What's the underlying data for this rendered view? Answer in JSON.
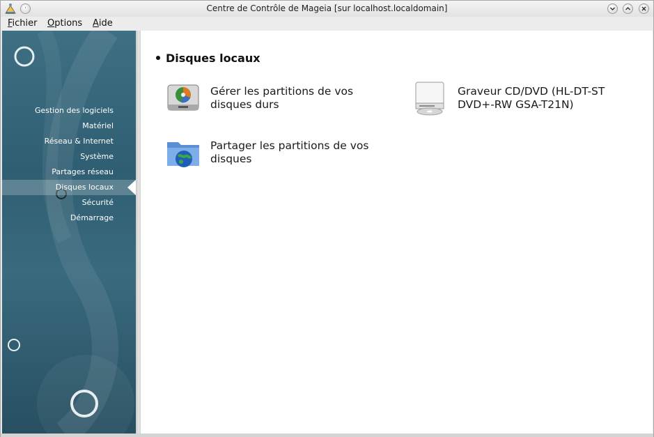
{
  "window": {
    "title": "Centre de Contrôle de Mageia  [sur localhost.localdomain]",
    "title_buttons": [
      "minimize",
      "maximize",
      "close"
    ]
  },
  "menubar": [
    {
      "label": "Fichier",
      "mnemonic": "F",
      "rest": "ichier"
    },
    {
      "label": "Options",
      "mnemonic": "O",
      "rest": "ptions"
    },
    {
      "label": "Aide",
      "mnemonic": "A",
      "rest": "ide"
    }
  ],
  "sidebar": {
    "items": [
      {
        "label": "Gestion des logiciels"
      },
      {
        "label": "Matériel"
      },
      {
        "label": "Réseau & Internet"
      },
      {
        "label": "Système"
      },
      {
        "label": "Partages réseau"
      },
      {
        "label": "Disques locaux",
        "active": true
      },
      {
        "label": "Sécurité"
      },
      {
        "label": "Démarrage"
      }
    ]
  },
  "main": {
    "section_title": "Disques locaux",
    "tools": [
      {
        "label": "Gérer les partitions de vos disques durs",
        "icon": "harddisk-partition-icon"
      },
      {
        "label": "Graveur CD/DVD (HL-DT-ST DVD+-RW GSA-T21N)",
        "icon": "optical-drive-icon"
      },
      {
        "label": "Partager les partitions de vos disques",
        "icon": "shared-folder-icon"
      }
    ]
  },
  "colors": {
    "sidebar_bg": "#2f5e72",
    "main_bg": "#ffffff",
    "text": "#1a1a1a"
  }
}
